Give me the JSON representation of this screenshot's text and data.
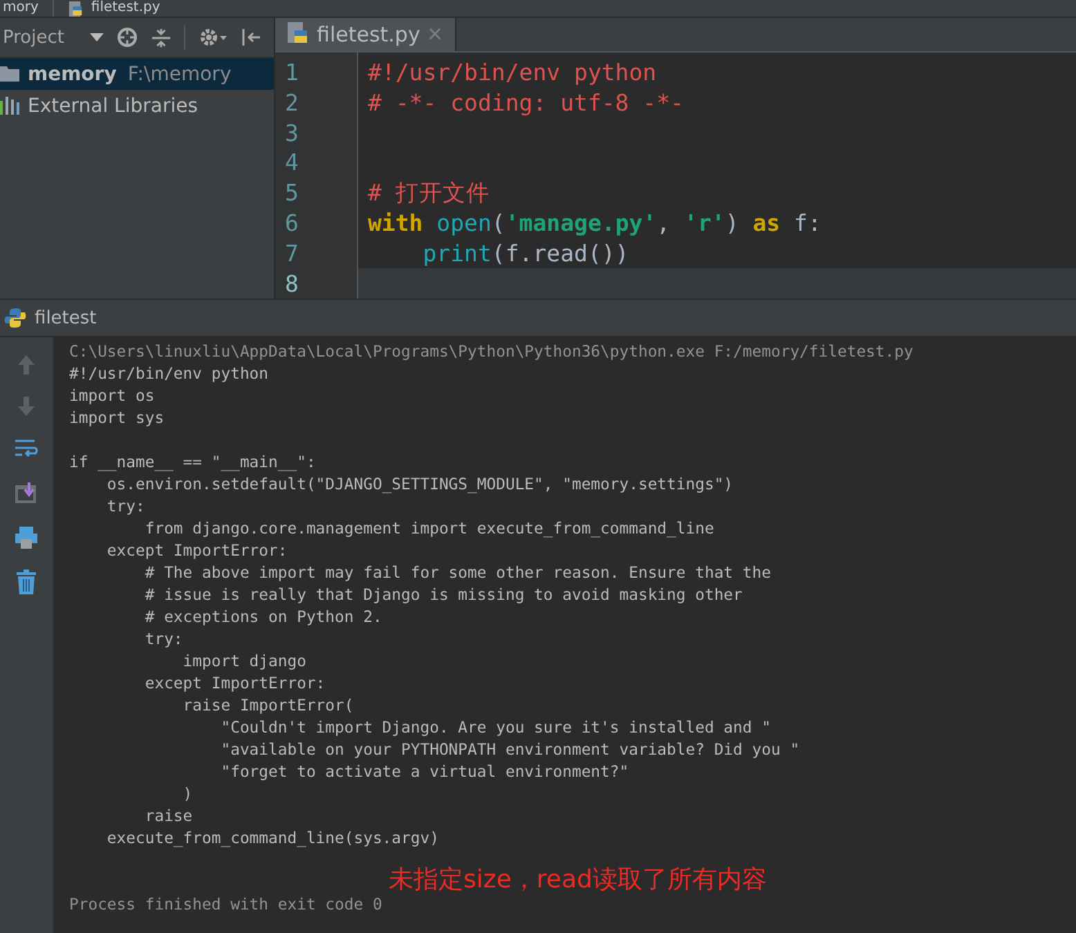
{
  "breadcrumbs": [
    {
      "label": "mory"
    },
    {
      "label": "filetest.py"
    }
  ],
  "project_panel": {
    "title": "Project",
    "items": [
      {
        "kind": "folder",
        "name": "memory",
        "path": "F:\\memory",
        "selected": true
      },
      {
        "kind": "library",
        "name": "External Libraries",
        "selected": false
      }
    ]
  },
  "editor": {
    "tabs": [
      {
        "label": "filetest.py",
        "selected": true
      }
    ],
    "lines": [
      {
        "number": "1",
        "current": false,
        "tokens": [
          {
            "kind": "comment",
            "text": "#!/usr/bin/env python"
          }
        ]
      },
      {
        "number": "2",
        "current": false,
        "tokens": [
          {
            "kind": "comment",
            "text": "# -*- coding: utf-8 -*-"
          }
        ]
      },
      {
        "number": "3",
        "current": false
      },
      {
        "number": "4",
        "current": false
      },
      {
        "number": "5",
        "current": false,
        "tokens": [
          {
            "kind": "comment",
            "text": "# 打开文件"
          }
        ]
      },
      {
        "number": "6",
        "current": false,
        "tokens": [
          {
            "kind": "keyword",
            "text": "with"
          },
          {
            "kind": "builtin",
            "text": " open"
          },
          {
            "kind": "plain",
            "text": "("
          },
          {
            "kind": "string",
            "text": "'manage.py'"
          },
          {
            "kind": "plain",
            "text": ", "
          },
          {
            "kind": "string",
            "text": "'r'"
          },
          {
            "kind": "plain",
            "text": ") "
          },
          {
            "kind": "keyword",
            "text": "as"
          },
          {
            "kind": "plain",
            "text": " f:"
          }
        ]
      },
      {
        "number": "7",
        "current": false,
        "indented": true,
        "tokens": [
          {
            "kind": "builtin",
            "text": "print"
          },
          {
            "kind": "plain",
            "text": "(f.read())"
          }
        ]
      },
      {
        "number": "8",
        "current": true
      }
    ]
  },
  "run_panel": {
    "title": "filetest",
    "console": [
      {
        "kind": "command",
        "text": "C:\\Users\\linuxliu\\AppData\\Local\\Programs\\Python\\Python36\\python.exe F:/memory/filetest.py"
      },
      {
        "kind": "output",
        "text": "#!/usr/bin/env python"
      },
      {
        "kind": "output",
        "text": "import os"
      },
      {
        "kind": "output",
        "text": "import sys"
      },
      {
        "kind": "blank"
      },
      {
        "kind": "output",
        "text": "if __name__ == \"__main__\":"
      },
      {
        "kind": "output",
        "text": "    os.environ.setdefault(\"DJANGO_SETTINGS_MODULE\", \"memory.settings\")"
      },
      {
        "kind": "output",
        "text": "    try:"
      },
      {
        "kind": "output",
        "text": "        from django.core.management import execute_from_command_line"
      },
      {
        "kind": "output",
        "text": "    except ImportError:"
      },
      {
        "kind": "output",
        "text": "        # The above import may fail for some other reason. Ensure that the"
      },
      {
        "kind": "output",
        "text": "        # issue is really that Django is missing to avoid masking other"
      },
      {
        "kind": "output",
        "text": "        # exceptions on Python 2."
      },
      {
        "kind": "output",
        "text": "        try:"
      },
      {
        "kind": "output",
        "text": "            import django"
      },
      {
        "kind": "output",
        "text": "        except ImportError:"
      },
      {
        "kind": "output",
        "text": "            raise ImportError("
      },
      {
        "kind": "output",
        "text": "                \"Couldn't import Django. Are you sure it's installed and \""
      },
      {
        "kind": "output",
        "text": "                \"available on your PYTHONPATH environment variable? Did you \""
      },
      {
        "kind": "output",
        "text": "                \"forget to activate a virtual environment?\""
      },
      {
        "kind": "output",
        "text": "            )"
      },
      {
        "kind": "output",
        "text": "        raise"
      },
      {
        "kind": "output",
        "text": "    execute_from_command_line(sys.argv)"
      },
      {
        "kind": "blank"
      },
      {
        "kind": "blank"
      },
      {
        "kind": "status",
        "text": "Process finished with exit code 0"
      }
    ],
    "annotation": "未指定size，read读取了所有内容"
  }
}
